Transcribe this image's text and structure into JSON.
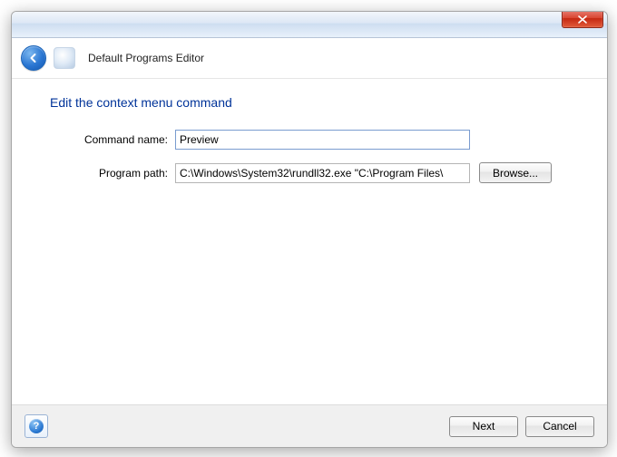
{
  "window": {
    "title": "Default Programs Editor"
  },
  "page": {
    "heading": "Edit the context menu command"
  },
  "form": {
    "command_label": "Command name:",
    "command_value": "Preview",
    "path_label": "Program path:",
    "path_value": "C:\\Windows\\System32\\rundll32.exe \"C:\\Program Files\\",
    "browse_label": "Browse..."
  },
  "footer": {
    "help_glyph": "?",
    "next_label": "Next",
    "cancel_label": "Cancel"
  },
  "colors": {
    "heading": "#003399",
    "focus_border": "#7a9ccf"
  }
}
